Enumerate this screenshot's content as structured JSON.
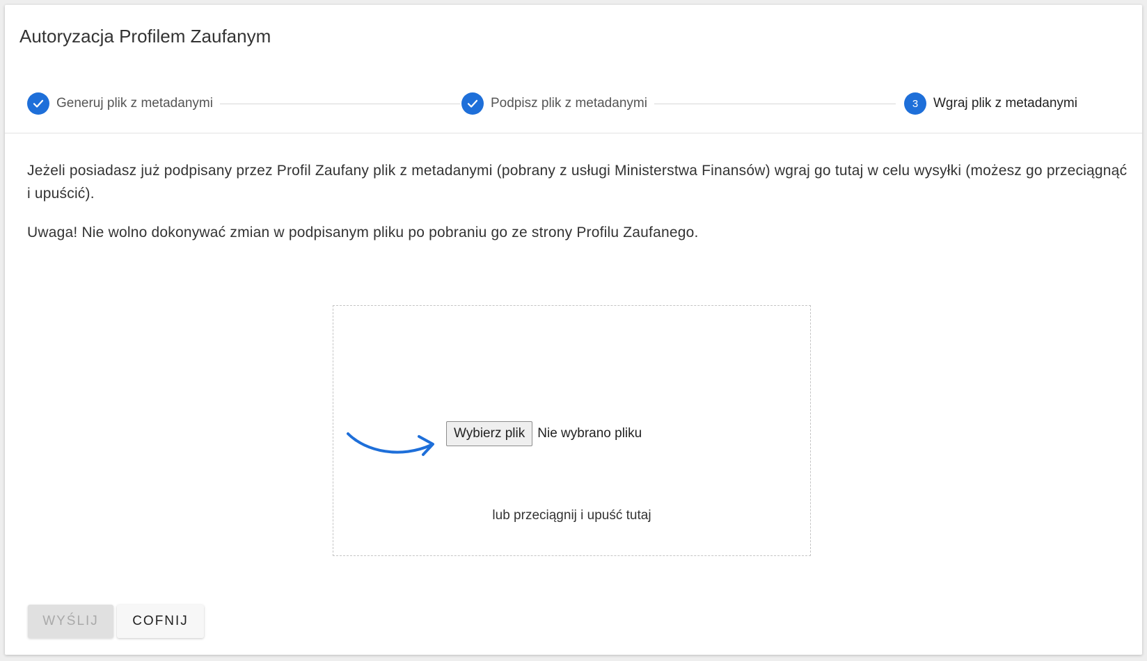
{
  "dialog": {
    "title": "Autoryzacja Profilem Zaufanym"
  },
  "stepper": {
    "steps": [
      {
        "label": "Generuj plik z metadanymi",
        "state": "completed",
        "icon": "check-icon"
      },
      {
        "label": "Podpisz plik z metadanymi",
        "state": "completed",
        "icon": "check-icon"
      },
      {
        "label": "Wgraj plik z metadanymi",
        "state": "active",
        "number": "3"
      }
    ],
    "accent_color": "#1e6fd9"
  },
  "content": {
    "info_text": "Jeżeli posiadasz już podpisany przez Profil Zaufany plik z metadanymi (pobrany z usługi Ministerstwa Finansów) wgraj go tutaj w celu wysyłki (możesz go przeciągnąć i upuścić).",
    "warning_text": "Uwaga! Nie wolno dokonywać zmian w podpisanym pliku po pobraniu go ze strony Profilu Zaufanego."
  },
  "upload": {
    "button_label": "Wybierz plik",
    "status_text": "Nie wybrano pliku",
    "drop_hint": "lub przeciągnij i upuść tutaj",
    "arrow_icon": "curved-arrow-icon"
  },
  "actions": {
    "send_label": "WYŚLIJ",
    "send_disabled": true,
    "back_label": "COFNIJ"
  }
}
